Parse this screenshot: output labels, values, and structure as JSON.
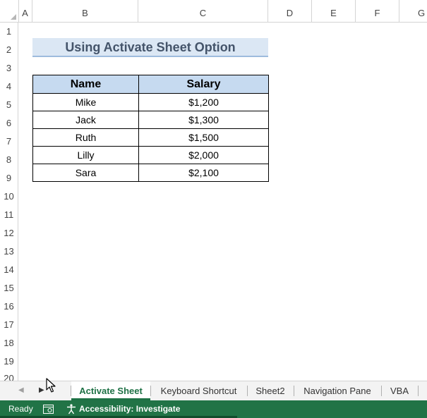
{
  "columns": [
    "A",
    "B",
    "C",
    "D",
    "E",
    "F",
    "G"
  ],
  "rows": [
    "1",
    "2",
    "3",
    "4",
    "5",
    "6",
    "7",
    "8",
    "9",
    "10",
    "11",
    "12",
    "13",
    "14",
    "15",
    "16",
    "17",
    "18",
    "19",
    "20"
  ],
  "title": "Using Activate Sheet Option",
  "table": {
    "headers": [
      "Name",
      "Salary"
    ],
    "rows": [
      [
        "Mike",
        "$1,200"
      ],
      [
        "Jack",
        "$1,300"
      ],
      [
        "Ruth",
        "$1,500"
      ],
      [
        "Lilly",
        "$2,000"
      ],
      [
        "Sara",
        "$2,100"
      ]
    ]
  },
  "sheet_tabs": [
    "Activate Sheet",
    "Keyboard Shortcut",
    "Sheet2",
    "Navigation Pane",
    "VBA"
  ],
  "active_tab": "Activate Sheet",
  "status": {
    "ready": "Ready",
    "accessibility": "Accessibility: Investigate"
  },
  "colors": {
    "accent": "#217346",
    "title_fill": "#dbe7f4",
    "header_fill": "#c6daf0",
    "title_text": "#44546a"
  }
}
